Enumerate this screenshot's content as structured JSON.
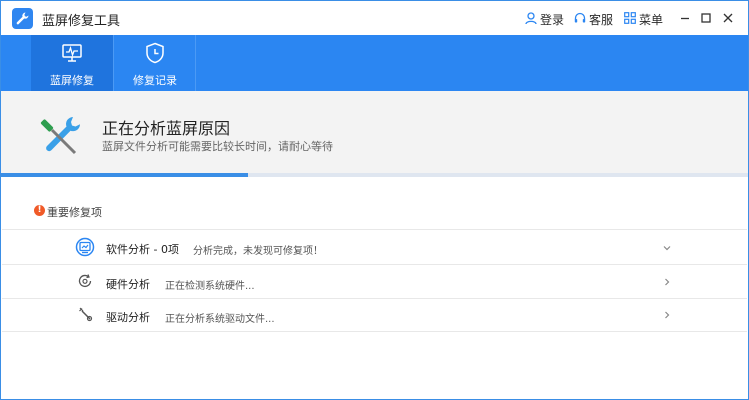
{
  "app": {
    "title": "蓝屏修复工具",
    "login_label": "登录",
    "service_label": "客服",
    "menu_label": "菜单"
  },
  "toolbar": {
    "tabs": [
      {
        "label": "蓝屏修复",
        "icon": "monitor-icon",
        "active": true
      },
      {
        "label": "修复记录",
        "icon": "clock-shield-icon",
        "active": false
      }
    ]
  },
  "status": {
    "title": "正在分析蓝屏原因",
    "subtitle": "蓝屏文件分析可能需要比较长时间，请耐心等待",
    "progress": 0.33
  },
  "section": {
    "title": "重要修复项",
    "items": [
      {
        "name": "软件分析 - 0项",
        "status": "分析完成，未发现可修复项！",
        "icon": "software-icon",
        "expanded": true
      },
      {
        "name": "硬件分析",
        "status": "正在检测系统硬件...",
        "icon": "hardware-icon",
        "expanded": false
      },
      {
        "name": "驱动分析",
        "status": "正在分析系统驱动文件...",
        "icon": "driver-icon",
        "expanded": false
      }
    ]
  },
  "colors": {
    "accent": "#2b86f2",
    "warning": "#f05a28",
    "tool_green": "#2e9e4f"
  }
}
